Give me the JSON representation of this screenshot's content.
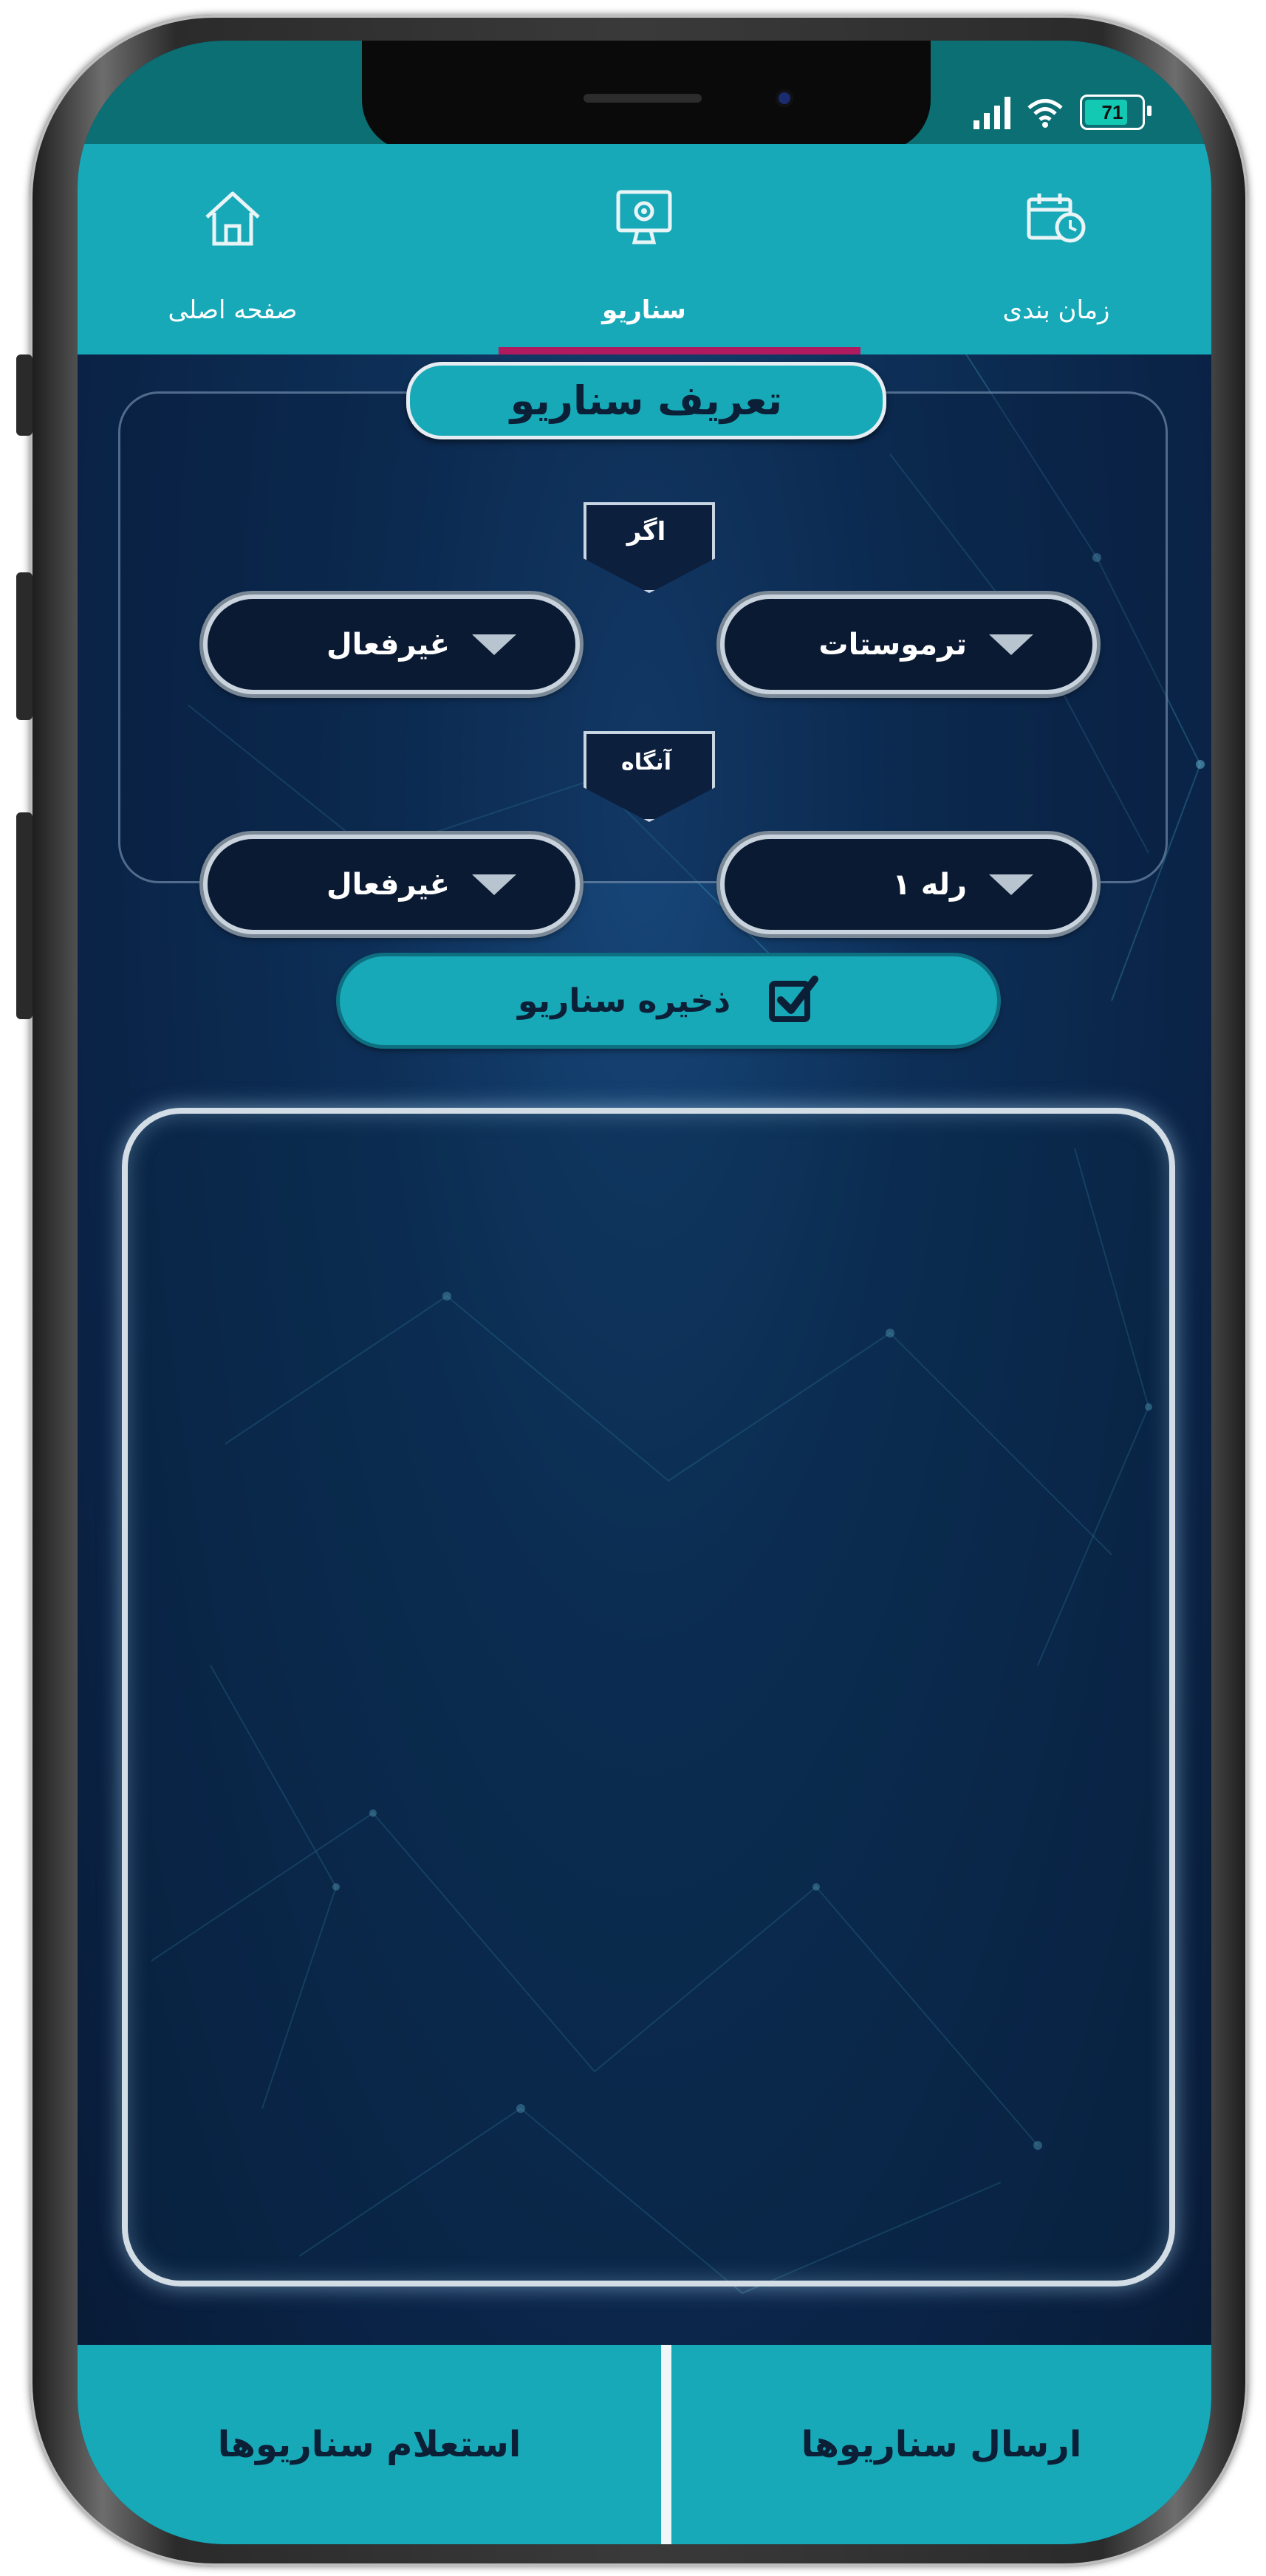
{
  "status_bar": {
    "battery_level": "71"
  },
  "tabs": [
    {
      "label": "صفحه اصلی",
      "icon": "home-icon"
    },
    {
      "label": "سناریو",
      "icon": "scenario-icon",
      "active": true
    },
    {
      "label": "زمان بندی",
      "icon": "schedule-icon"
    }
  ],
  "scenario": {
    "title": "تعریف سناریو",
    "if_label": "اگر",
    "then_label": "آنگاه",
    "if_device": "ترموستات",
    "if_state": "غیرفعال",
    "then_device": "رله ۱",
    "then_state": "غیرفعال",
    "save_label": "ذخیره سناریو"
  },
  "bottom_bar": {
    "send_label": "ارسال سناریوها",
    "inquiry_label": "استعلام سناریوها"
  },
  "colors": {
    "accent": "#17a9b8",
    "tab_indicator": "#b01a5f",
    "background_dark": "#0a2346",
    "text_dark": "#0b1f36"
  }
}
